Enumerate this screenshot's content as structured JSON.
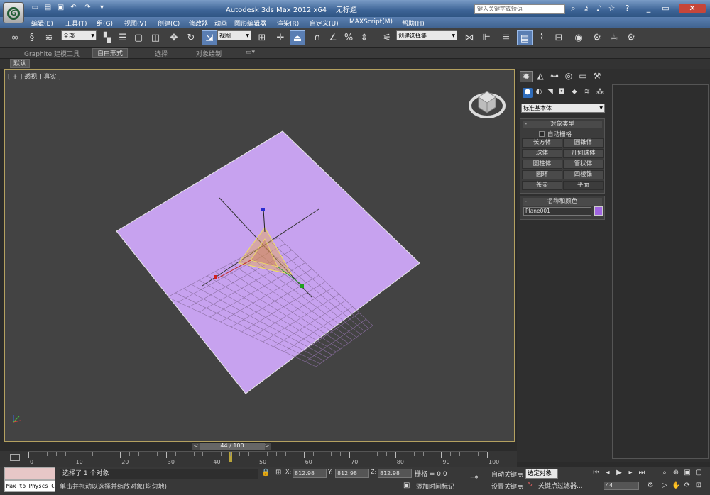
{
  "window": {
    "title": "Autodesk 3ds Max  2012 x64",
    "doc_name": "无标题"
  },
  "search": {
    "placeholder": "键入关键字或短语"
  },
  "menu": [
    "编辑(E)",
    "工具(T)",
    "组(G)",
    "视图(V)",
    "创建(C)",
    "修改器",
    "动画",
    "图形编辑器",
    "渲染(R)",
    "自定义(U)",
    "MAXScript(M)",
    "帮助(H)"
  ],
  "toolbar": {
    "filter": "全部",
    "ref_coord": "视图",
    "named_sel": "创建选择集"
  },
  "ribbon": {
    "tabs": [
      "Graphite 建模工具",
      "自由形式",
      "选择",
      "对象绘制"
    ],
    "sub": "默认"
  },
  "viewport": {
    "label": "[ + ] 透视 ] 真实 ]"
  },
  "command_panel": {
    "category": "标准基本体",
    "object_type": {
      "title": "对象类型",
      "autogrid": "自动栅格",
      "buttons": [
        "长方体",
        "圆锥体",
        "球体",
        "几何球体",
        "圆柱体",
        "管状体",
        "圆环",
        "四棱锥",
        "茶壶",
        "平面"
      ]
    },
    "name_color": {
      "title": "名称和颜色",
      "name": "Plane001",
      "color": "#a065e0"
    }
  },
  "timeline": {
    "slider_label": "44 / 100",
    "current": 44,
    "max": 100,
    "labels": [
      "0",
      "10",
      "20",
      "30",
      "40",
      "50",
      "60",
      "70",
      "80",
      "90",
      "100"
    ]
  },
  "status": {
    "selection": "选择了 1 个对象",
    "prompt": "单击并拖动以选择并缩放对象(均匀地)",
    "x_label": "X:",
    "x": "812.98",
    "y_label": "Y:",
    "y": "812.98",
    "z_label": "Z:",
    "z": "812.98",
    "grid": "栅格 = 0.0",
    "add_time_tag": "添加时间标记",
    "auto_key": "自动关键点",
    "set_key": "设置关键点",
    "selected_set": "选定对象",
    "key_filters": "关键点过滤器...",
    "frame": "44",
    "physics": "Max to Physcs C"
  }
}
